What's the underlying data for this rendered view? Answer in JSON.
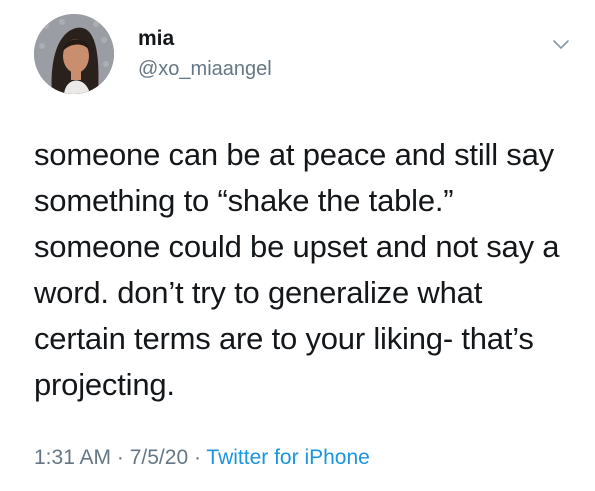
{
  "user": {
    "display_name": "mia",
    "handle": "@xo_miaangel"
  },
  "tweet": {
    "text": "someone can be at peace and still say something to “shake the table.” someone could be upset and not say a word. don’t try to generalize what certain terms are to your liking- that’s projecting."
  },
  "meta": {
    "time": "1:31 AM",
    "date": "7/5/20",
    "separator": " · ",
    "source": "Twitter for iPhone"
  },
  "icons": {
    "avatar": "profile-photo",
    "menu": "chevron-down-icon"
  },
  "colors": {
    "text": "#14171a",
    "secondary": "#657786",
    "link": "#1b95e0"
  }
}
